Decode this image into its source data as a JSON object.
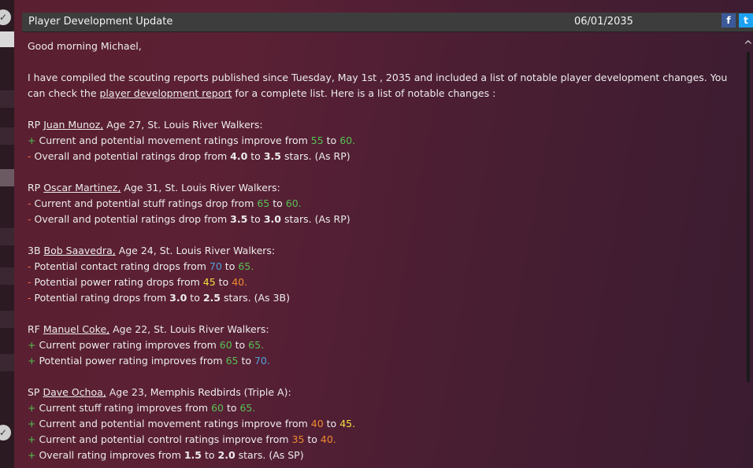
{
  "window": {
    "title": "Player Development Update",
    "date": "06/01/2035",
    "facebook_label": "f",
    "twitter_label": "t"
  },
  "message": {
    "greeting": "Good morning Michael,",
    "intro_1": "I have compiled the scouting reports published since Tuesday, May 1st , 2035 and included a list of notable player development changes. You",
    "intro_2a": "can check the ",
    "intro_link": "player development report",
    "intro_2b": " for a complete list. Here is a list of notable changes :"
  },
  "players": [
    {
      "pos": "RP",
      "name": "Juan Munoz,",
      "info": "Age 27, St. Louis River Walkers:",
      "lines": [
        {
          "sign": "+",
          "text": "Current and potential movement ratings improve from ",
          "v1": "55",
          "mid": " to ",
          "v2": "60.",
          "tail": ""
        },
        {
          "sign": "-",
          "text": "Overall and potential ratings drop from ",
          "v1": "4.0",
          "mid": " to ",
          "v2": "3.5",
          "tail": " stars. (As RP)"
        }
      ]
    },
    {
      "pos": "RP",
      "name": "Oscar Martinez,",
      "info": "Age 31, St. Louis River Walkers:",
      "lines": [
        {
          "sign": "-",
          "text": "Current and potential stuff ratings drop from ",
          "v1": "65",
          "mid": " to ",
          "v2": "60.",
          "tail": ""
        },
        {
          "sign": "-",
          "text": "Overall and potential ratings drop from ",
          "v1": "3.5",
          "mid": " to ",
          "v2": "3.0",
          "tail": " stars. (As RP)"
        }
      ]
    },
    {
      "pos": "3B",
      "name": "Bob Saavedra,",
      "info": "Age 24, St. Louis River Walkers:",
      "lines": [
        {
          "sign": "-",
          "text": "Potential contact rating drops from ",
          "v1": "70",
          "mid": " to ",
          "v2": "65.",
          "tail": ""
        },
        {
          "sign": "-",
          "text": "Potential power rating drops from ",
          "v1": "45",
          "mid": " to ",
          "v2": "40.",
          "tail": ""
        },
        {
          "sign": "-",
          "text": "Potential rating drops from ",
          "v1": "3.0",
          "mid": " to ",
          "v2": "2.5",
          "tail": " stars. (As 3B)"
        }
      ]
    },
    {
      "pos": "RF",
      "name": "Manuel Coke,",
      "info": "Age 22, St. Louis River Walkers:",
      "lines": [
        {
          "sign": "+",
          "text": "Current power rating improves from ",
          "v1": "60",
          "mid": " to ",
          "v2": "65.",
          "tail": ""
        },
        {
          "sign": "+",
          "text": "Potential power rating improves from ",
          "v1": "65",
          "mid": " to ",
          "v2": "70.",
          "tail": ""
        }
      ]
    },
    {
      "pos": "SP",
      "name": "Dave Ochoa,",
      "info": "Age 23, Memphis Redbirds (Triple A):",
      "lines": [
        {
          "sign": "+",
          "text": "Current stuff rating improves from ",
          "v1": "60",
          "mid": " to ",
          "v2": "65.",
          "tail": ""
        },
        {
          "sign": "+",
          "text": "Current and potential movement ratings improve from ",
          "v1": "40",
          "mid": " to ",
          "v2": "45.",
          "tail": ""
        },
        {
          "sign": "+",
          "text": "Current and potential control ratings improve from ",
          "v1": "35",
          "mid": " to ",
          "v2": "40.",
          "tail": ""
        },
        {
          "sign": "+",
          "text": "Overall rating improves from ",
          "v1": "1.5",
          "mid": " to ",
          "v2": "2.0",
          "tail": " stars. (As SP)"
        }
      ]
    }
  ],
  "colors": {
    "improve": "#4fc04f",
    "drop": "#ff6b4a",
    "rating_green": "#55c255",
    "rating_blue": "#4fa0d8",
    "rating_yellow": "#f0e040",
    "rating_orange": "#f08a30"
  }
}
